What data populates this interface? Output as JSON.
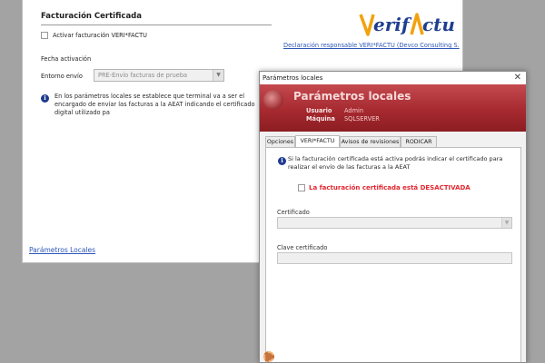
{
  "background": {
    "section_title": "Facturación Certificada",
    "activate_label": "Activar facturación VERI*FACTU",
    "brand_logo": "verifactu",
    "brand_link": "Declaración responsable VERI*FACTU (Devco Consulting S.",
    "fecha_label": "Fecha activación",
    "entorno_label": "Entorno envío",
    "entorno_value": "PRE-Envío facturas de prueba",
    "info_text": "En los parámetros locales se establece que terminal va a ser el encargado de enviar las facturas a la AEAT indicando el certificado digital utilizado pa",
    "local_params_link": "Parámetros Locales"
  },
  "dialog": {
    "title": "Parámetros locales",
    "close_glyph": "✕",
    "banner_title": "Parámetros locales",
    "usuario_key": "Usuario",
    "usuario_value": "Admin",
    "maquina_key": "Máquina",
    "maquina_value": "SQLSERVER",
    "tabs": [
      {
        "label": "Opciones"
      },
      {
        "label": "VERI*FACTU"
      },
      {
        "label": "Avisos de revisiones"
      },
      {
        "label": "RODICAR"
      }
    ],
    "active_tab": "VERI*FACTU",
    "info_text": "Si la facturación certificada está activa podrás indicar el certificado para realizar el envío de las facturas a la AEAT",
    "status_warning": "La facturación certificada está DESACTIVADA",
    "certificado_label": "Certificado",
    "clave_label": "Clave certificado"
  },
  "colors": {
    "banner": "#a62a30",
    "warning": "#e3262f",
    "link": "#2c56b8",
    "info_icon": "#1f3b8f"
  }
}
